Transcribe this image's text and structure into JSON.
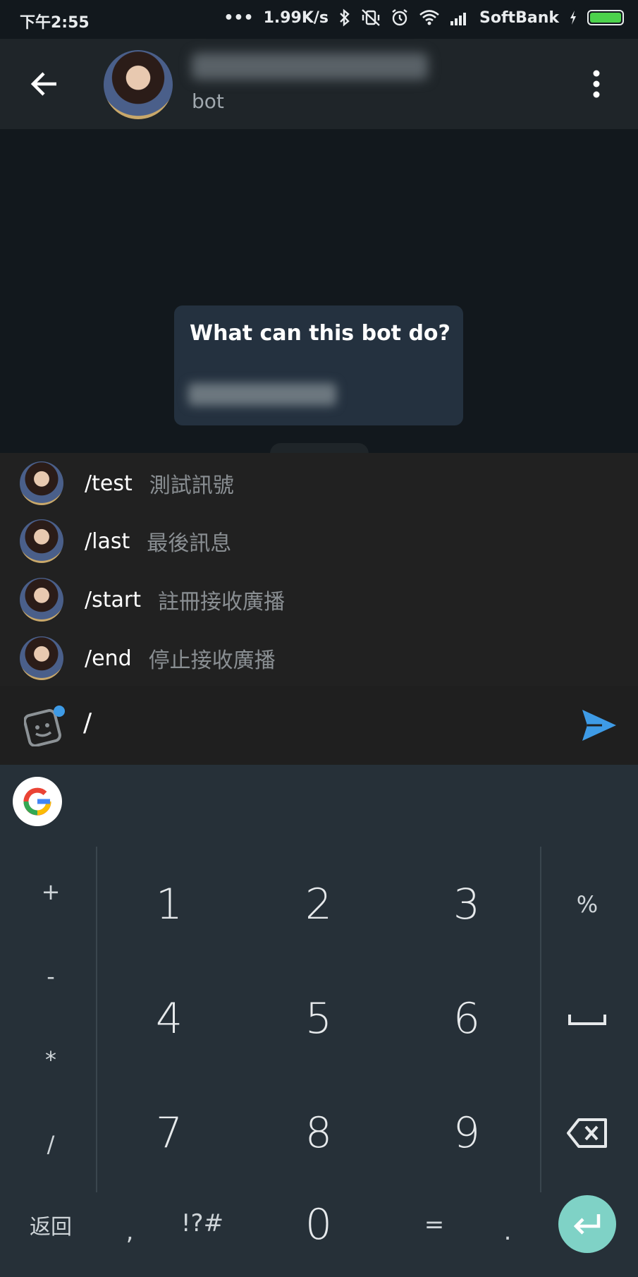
{
  "status_bar": {
    "time": "下午2:55",
    "dots": "•••",
    "speed": "1.99K/s",
    "carrier": "SoftBank",
    "icons": [
      "bluetooth-icon",
      "vibrate-off-icon",
      "alarm-icon",
      "wifi-icon",
      "signal-icon",
      "charging-icon",
      "battery-icon"
    ]
  },
  "header": {
    "subtitle": "bot",
    "icons": [
      "back-arrow-icon",
      "more-vert-icon"
    ]
  },
  "chat": {
    "bubble_title": "What can this bot do?"
  },
  "commands": [
    {
      "command": "/test",
      "description": "測試訊號"
    },
    {
      "command": "/last",
      "description": "最後訊息"
    },
    {
      "command": "/start",
      "description": "註冊接收廣播"
    },
    {
      "command": "/end",
      "description": "停止接收廣播"
    }
  ],
  "input": {
    "value": "/",
    "icons": [
      "sticker-icon",
      "send-icon"
    ]
  },
  "suggestion_bar": {
    "logo_letter": "G"
  },
  "keyboard": {
    "left_symbols": [
      "+",
      "-",
      "*",
      "/"
    ],
    "numbers": [
      "1",
      "2",
      "3",
      "4",
      "5",
      "6",
      "7",
      "8",
      "9"
    ],
    "right_keys": [
      "%"
    ],
    "bottom": {
      "back": "返回",
      "comma": ",",
      "symbols": "!?#",
      "zero": "0",
      "equals": "=",
      "period": "."
    },
    "icons": [
      "space-icon",
      "backspace-icon",
      "enter-icon"
    ],
    "accent": "#7fd2c6"
  },
  "colors": {
    "background": "#12181d",
    "header": "#1f2529",
    "bubble": "#24313f",
    "send": "#3e9be6"
  }
}
